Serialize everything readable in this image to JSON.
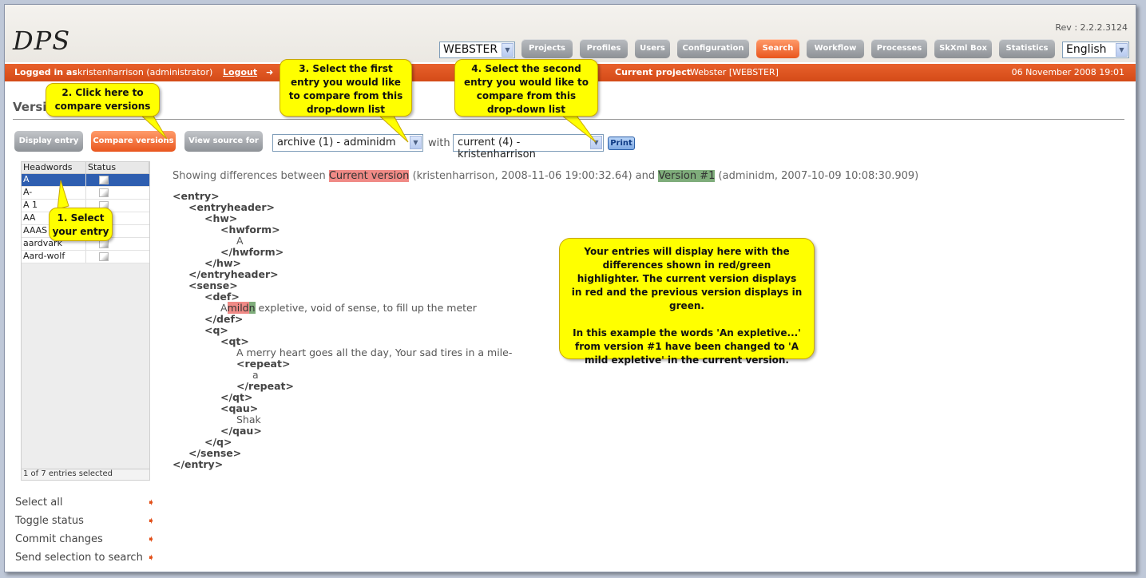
{
  "app": {
    "logo": "DPS",
    "rev": "Rev : 2.2.2.3124"
  },
  "project_select": {
    "value": "WEBSTER"
  },
  "nav": [
    {
      "label": "Projects",
      "w": 64
    },
    {
      "label": "Profiles",
      "w": 60
    },
    {
      "label": "Users",
      "w": 44
    },
    {
      "label": "Configuration",
      "w": 90
    },
    {
      "label": "Search",
      "w": 54,
      "active": true
    },
    {
      "label": "Workflow",
      "w": 72
    },
    {
      "label": "Processes",
      "w": 70
    },
    {
      "label": "SkXml Box",
      "w": 72
    },
    {
      "label": "Statistics",
      "w": 70
    }
  ],
  "language_select": {
    "value": "English"
  },
  "status_bar": {
    "logged_in_label": "Logged in as",
    "user": "kristenharrison (administrator)",
    "logout": "Logout",
    "current_project_label": "Current project",
    "current_project": "Webster [WEBSTER]",
    "datetime": "06 November 2008 19:01"
  },
  "page_title": "Versi",
  "actions": {
    "display_entry": "Display entry",
    "compare_versions": "Compare versions",
    "view_source": "View source for"
  },
  "compare": {
    "first_value": "archive (1) - adminidm",
    "with_label": "with",
    "second_value": "current (4) - kristenharrison",
    "print": "Print"
  },
  "list": {
    "headers": [
      "Headwords",
      "Status"
    ],
    "rows": [
      "A",
      "A-",
      "A 1",
      "AA",
      "AAAS",
      "aardvark",
      "Aard-wolf"
    ],
    "footer": "1 of 7 entries selected"
  },
  "side_actions": [
    "Select all",
    "Toggle status",
    "Commit changes",
    "Send selection to search"
  ],
  "diff": {
    "prefix": "Showing differences between",
    "current": "Current version",
    "current_meta": "(kristenharrison, 2008-11-06 19:00:32.64) and",
    "previous": "Version #1",
    "previous_meta": "(adminidm, 2007-10-09 10:08:30.909)"
  },
  "xml": {
    "entry_open": "<entry>",
    "entryheader_open": "<entryheader>",
    "hw_open": "<hw>",
    "hwform_open": "<hwform>",
    "hwform_text": "A",
    "hwform_close": "</hwform>",
    "hw_close": "</hw>",
    "entryheader_close": "</entryheader>",
    "sense_open": "<sense>",
    "def_open": "<def>",
    "def_a": "A",
    "def_mild": "mild",
    "def_n": "n",
    "def_rest": " expletive, void of sense, to fill up the meter",
    "def_close": "</def>",
    "q_open": "<q>",
    "qt_open": "<qt>",
    "qt_text": "A merry heart goes all the day, Your sad tires in a mile-",
    "repeat_open": "<repeat>",
    "repeat_text": "a",
    "repeat_close": "</repeat>",
    "qt_close": "</qt>",
    "qau_open": "<qau>",
    "qau_text": "Shak",
    "qau_close": "</qau>",
    "q_close": "</q>",
    "sense_close": "</sense>",
    "entry_close": "</entry>"
  },
  "callouts": {
    "c1": "1. Select your entry",
    "c2": "2. Click here to compare versions",
    "c3": "3. Select the first entry you would like to compare from this drop-down list",
    "c4": "4. Select the second entry you would like to compare from this drop-down list",
    "c5_p1": "Your entries will display here with the differences shown in red/green highlighter. The current version displays in red and the previous version displays in green.",
    "c5_p2": "In this example the words 'An expletive...' from version #1 have been changed to 'A mild expletive' in the current version."
  },
  "colors": {
    "accent": "#e9561e",
    "highlight_current": "#f08a86",
    "highlight_previous": "#7fad7b",
    "callout": "#ffff00"
  }
}
